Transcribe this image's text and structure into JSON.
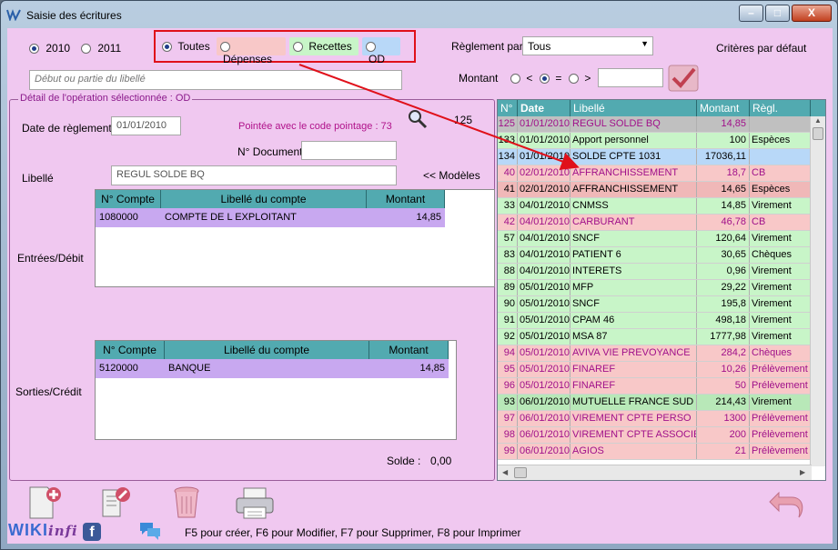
{
  "window": {
    "title": "Saisie des écritures",
    "close_label": "X"
  },
  "filters": {
    "year_2010": "2010",
    "year_2011": "2011",
    "type_all": "Toutes",
    "type_expenses": "Dépenses",
    "type_income": "Recettes",
    "type_od": "OD",
    "libelle_placeholder": "Début ou partie du libellé",
    "reglement_label": "Règlement par",
    "reglement_value": "Tous",
    "default_criteria": "Critères par défaut",
    "montant_label": "Montant",
    "op_lt": "<",
    "op_eq": "=",
    "op_gt": ">",
    "montant_value": ""
  },
  "detail": {
    "legend": "Détail de l'opération sélectionnée : OD",
    "date_label": "Date de règlement",
    "date_value": "01/01/2010",
    "pointage": "Pointée avec le code pointage : 73",
    "number": "125",
    "doc_label": "N° Document",
    "doc_value": "",
    "libelle_label": "Libellé",
    "libelle_value": "REGUL SOLDE BQ",
    "models_link": "<< Modèles",
    "debit_label": "Entrées/Débit",
    "credit_label": "Sorties/Crédit",
    "solde_label": "Solde :",
    "solde_value": "0,00",
    "debit_table": {
      "headers": [
        "N° Compte",
        "Libellé du compte",
        "Montant"
      ],
      "rows": [
        {
          "compte": "1080000",
          "libelle": "COMPTE DE L EXPLOITANT",
          "montant": "14,85"
        }
      ]
    },
    "credit_table": {
      "headers": [
        "N° Compte",
        "Libellé du compte",
        "Montant"
      ],
      "rows": [
        {
          "compte": "5120000",
          "libelle": "BANQUE",
          "montant": "14,85"
        }
      ]
    }
  },
  "grid": {
    "headers": [
      "N°",
      "Date",
      "Libellé",
      "Montant",
      "Règl."
    ],
    "rows": [
      {
        "n": "125",
        "date": "01/01/2010",
        "libelle": "REGUL SOLDE BQ",
        "montant": "14,85",
        "regl": "",
        "kind": "od-selected"
      },
      {
        "n": "133",
        "date": "01/01/2010",
        "libelle": "Apport personnel",
        "montant": "100",
        "regl": "Espèces",
        "kind": "recette"
      },
      {
        "n": "134",
        "date": "01/01/2010",
        "libelle": "SOLDE CPTE 1031",
        "montant": "17036,11",
        "regl": "",
        "kind": "od"
      },
      {
        "n": "40",
        "date": "02/01/2010",
        "libelle": "AFFRANCHISSEMENT",
        "montant": "18,7",
        "regl": "CB",
        "kind": "depense"
      },
      {
        "n": "41",
        "date": "02/01/2010",
        "libelle": "AFFRANCHISSEMENT",
        "montant": "14,65",
        "regl": "Espèces",
        "kind": "depense-dark"
      },
      {
        "n": "33",
        "date": "04/01/2010",
        "libelle": "CNMSS",
        "montant": "14,85",
        "regl": "Virement",
        "kind": "recette"
      },
      {
        "n": "42",
        "date": "04/01/2010",
        "libelle": "CARBURANT",
        "montant": "46,78",
        "regl": "CB",
        "kind": "depense"
      },
      {
        "n": "57",
        "date": "04/01/2010",
        "libelle": "SNCF",
        "montant": "120,64",
        "regl": "Virement",
        "kind": "recette"
      },
      {
        "n": "83",
        "date": "04/01/2010",
        "libelle": "PATIENT 6",
        "montant": "30,65",
        "regl": "Chèques",
        "kind": "recette"
      },
      {
        "n": "88",
        "date": "04/01/2010",
        "libelle": "INTERETS",
        "montant": "0,96",
        "regl": "Virement",
        "kind": "recette"
      },
      {
        "n": "89",
        "date": "05/01/2010",
        "libelle": "MFP",
        "montant": "29,22",
        "regl": "Virement",
        "kind": "recette"
      },
      {
        "n": "90",
        "date": "05/01/2010",
        "libelle": "SNCF",
        "montant": "195,8",
        "regl": "Virement",
        "kind": "recette"
      },
      {
        "n": "91",
        "date": "05/01/2010",
        "libelle": "CPAM 46",
        "montant": "498,18",
        "regl": "Virement",
        "kind": "recette"
      },
      {
        "n": "92",
        "date": "05/01/2010",
        "libelle": "MSA 87",
        "montant": "1777,98",
        "regl": "Virement",
        "kind": "recette"
      },
      {
        "n": "94",
        "date": "05/01/2010",
        "libelle": "AVIVA VIE PREVOYANCE",
        "montant": "284,2",
        "regl": "Chèques",
        "kind": "depense"
      },
      {
        "n": "95",
        "date": "05/01/2010",
        "libelle": "FINAREF",
        "montant": "10,26",
        "regl": "Prélèvement",
        "kind": "depense"
      },
      {
        "n": "96",
        "date": "05/01/2010",
        "libelle": "FINAREF",
        "montant": "50",
        "regl": "Prélèvement",
        "kind": "depense"
      },
      {
        "n": "93",
        "date": "06/01/2010",
        "libelle": "MUTUELLE FRANCE SUD",
        "montant": "214,43",
        "regl": "Virement",
        "kind": "recette-dark"
      },
      {
        "n": "97",
        "date": "06/01/2010",
        "libelle": "VIREMENT CPTE PERSO",
        "montant": "1300",
        "regl": "Prélèvement",
        "kind": "depense"
      },
      {
        "n": "98",
        "date": "06/01/2010",
        "libelle": "VIREMENT CPTE ASSOCIE",
        "montant": "200",
        "regl": "Prélèvement",
        "kind": "depense"
      },
      {
        "n": "99",
        "date": "06/01/2010",
        "libelle": "AGIOS",
        "montant": "21",
        "regl": "Prélèvement",
        "kind": "depense"
      }
    ]
  },
  "footer": {
    "shortcuts": "F5 pour créer, F6 pour Modifier, F7 pour Supprimer, F8 pour Imprimer",
    "logo_left": "WIKI",
    "logo_right": "infi",
    "facebook_letter": "f"
  },
  "colors": {
    "background": "#f0c8f0",
    "header": "#52aab0",
    "recette": "#c8f5c8",
    "depense": "#f8c8c8",
    "od": "#c8e0f8",
    "annotation": "#e0101a"
  }
}
